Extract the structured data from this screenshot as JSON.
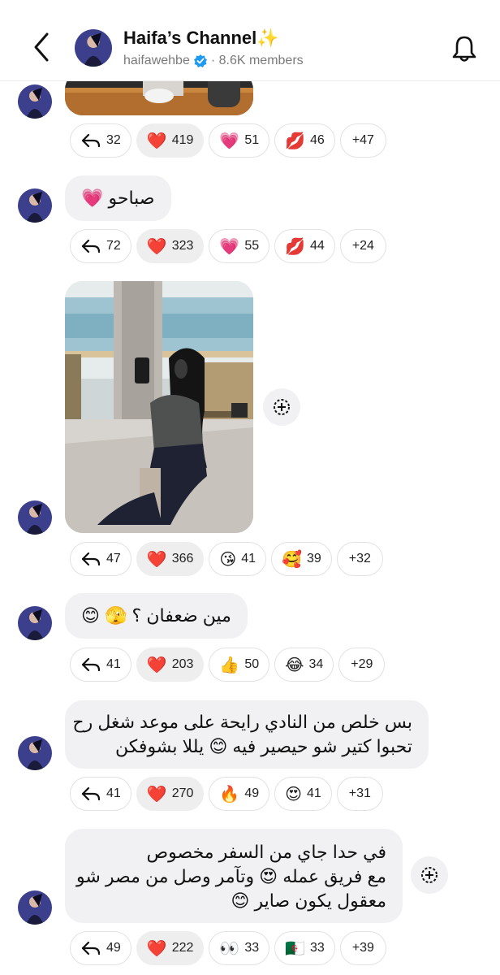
{
  "header": {
    "title": "Haifa’s Channel",
    "title_emoji": "✨",
    "handle": "haifawehbe",
    "members": "· 8.6K members"
  },
  "posts": [
    {
      "type": "image",
      "text": [],
      "reactions": [
        {
          "icon": "reply-icon",
          "count": "32"
        },
        {
          "icon": "red-heart-emoji",
          "glyph": "❤️",
          "count": "419"
        },
        {
          "icon": "pink-sparkling-heart-emoji",
          "glyph": "💗",
          "count": "51"
        },
        {
          "icon": "kiss-mark-emoji",
          "glyph": "💋",
          "count": "46"
        },
        {
          "icon": "more",
          "count": "+47"
        }
      ]
    },
    {
      "type": "text",
      "text": [
        "صباحو 💗"
      ],
      "reactions": [
        {
          "icon": "reply-icon",
          "count": "72"
        },
        {
          "icon": "red-heart-emoji",
          "glyph": "❤️",
          "count": "323"
        },
        {
          "icon": "pink-sparkling-heart-emoji",
          "glyph": "💗",
          "count": "55"
        },
        {
          "icon": "kiss-mark-emoji",
          "glyph": "💋",
          "count": "44"
        },
        {
          "icon": "more",
          "count": "+24"
        }
      ]
    },
    {
      "type": "image",
      "text": [],
      "reactions": [
        {
          "icon": "reply-icon",
          "count": "47"
        },
        {
          "icon": "red-heart-emoji",
          "glyph": "❤️",
          "count": "366"
        },
        {
          "icon": "kissing-face-emoji",
          "glyph": "😘",
          "count": "41"
        },
        {
          "icon": "smiling-face-hearts-emoji",
          "glyph": "🥰",
          "count": "39"
        },
        {
          "icon": "more",
          "count": "+32"
        }
      ]
    },
    {
      "type": "text",
      "text": [
        "مين ضعفان ؟ 🫣 😊"
      ],
      "reactions": [
        {
          "icon": "reply-icon",
          "count": "41"
        },
        {
          "icon": "red-heart-emoji",
          "glyph": "❤️",
          "count": "203"
        },
        {
          "icon": "thumbs-up-emoji",
          "glyph": "👍",
          "count": "50"
        },
        {
          "icon": "tears-of-joy-emoji",
          "glyph": "😂",
          "count": "34"
        },
        {
          "icon": "more",
          "count": "+29"
        }
      ]
    },
    {
      "type": "text",
      "text": [
        "بس خلص من النادي  رايحة على موعد شغل رح",
        "تحبوا كتير شو حيصير فيه 😊 يللا بشوفكن"
      ],
      "reactions": [
        {
          "icon": "reply-icon",
          "count": "41"
        },
        {
          "icon": "red-heart-emoji",
          "glyph": "❤️",
          "count": "270"
        },
        {
          "icon": "fire-emoji",
          "glyph": "🔥",
          "count": "49"
        },
        {
          "icon": "heart-eyes-emoji",
          "glyph": "😍",
          "count": "41"
        },
        {
          "icon": "more",
          "count": "+31"
        }
      ]
    },
    {
      "type": "text",
      "text": [
        "في حدا جاي من السفر مخصوص",
        "مع فريق عمله 😍 وتآمر وصل من مصر  شو",
        "معقول يكون صاير 😊"
      ],
      "reactions": [
        {
          "icon": "reply-icon",
          "count": "49"
        },
        {
          "icon": "red-heart-emoji",
          "glyph": "❤️",
          "count": "222"
        },
        {
          "icon": "eyes-emoji",
          "glyph": "👀",
          "count": "33"
        },
        {
          "icon": "algeria-flag-emoji",
          "glyph": "🇩🇿",
          "count": "33"
        },
        {
          "icon": "more",
          "count": "+39"
        }
      ]
    }
  ]
}
